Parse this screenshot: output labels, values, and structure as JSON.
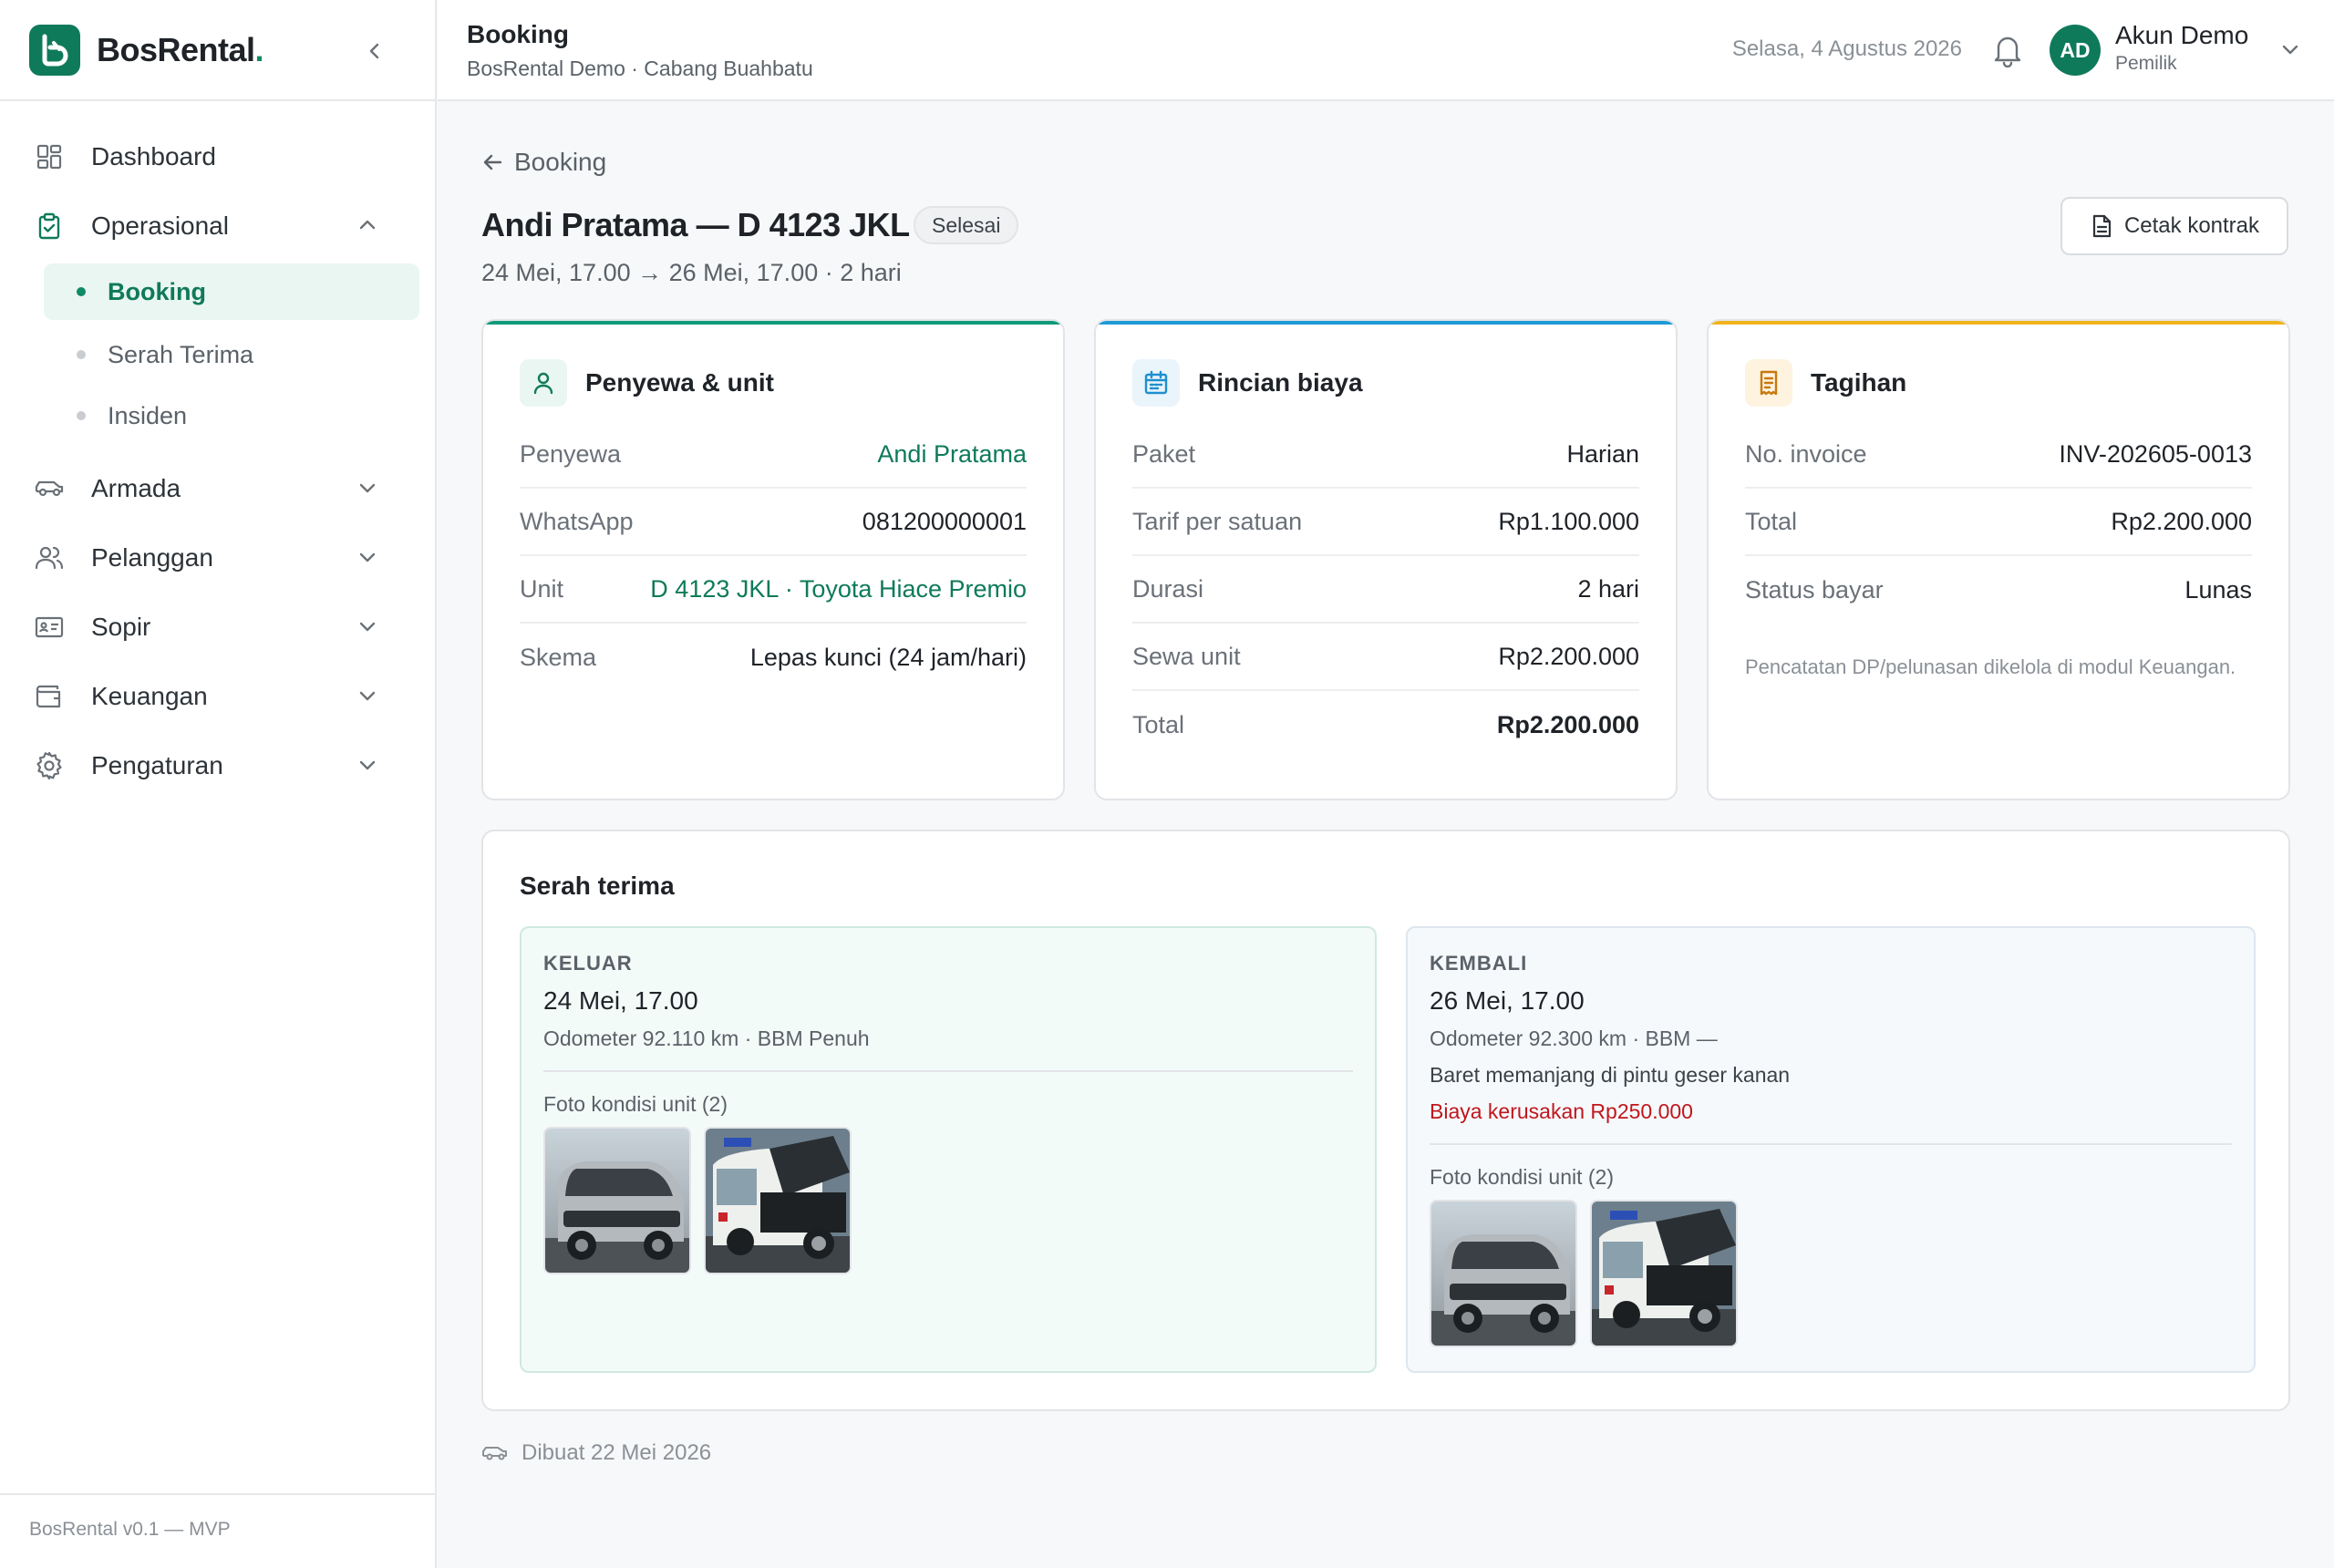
{
  "app": {
    "brand": "BosRental",
    "brand_dot": ".",
    "version": "BosRental v0.1 — MVP"
  },
  "sidebar": {
    "items": [
      {
        "label": "Dashboard",
        "icon": "grid-icon"
      },
      {
        "label": "Operasional",
        "icon": "clipboard-check-icon",
        "expanded": true
      },
      {
        "label": "Armada",
        "icon": "car-icon"
      },
      {
        "label": "Pelanggan",
        "icon": "users-icon"
      },
      {
        "label": "Sopir",
        "icon": "id-card-icon"
      },
      {
        "label": "Keuangan",
        "icon": "wallet-icon"
      },
      {
        "label": "Pengaturan",
        "icon": "gear-icon"
      }
    ],
    "sub_items": [
      {
        "label": "Booking",
        "active": true
      },
      {
        "label": "Serah Terima",
        "active": false
      },
      {
        "label": "Insiden",
        "active": false
      }
    ]
  },
  "header": {
    "title": "Booking",
    "subtitle": "BosRental Demo · Cabang Buahbatu",
    "date": "Selasa, 4 Agustus 2026",
    "user": {
      "initials": "AD",
      "name": "Akun Demo",
      "role": "Pemilik"
    }
  },
  "page": {
    "back_label": "Booking",
    "title": "Andi Pratama — D 4123 JKL",
    "status": "Selesai",
    "period": "24 Mei, 17.00 → 26 Mei, 17.00 · 2 hari",
    "print_label": "Cetak kontrak",
    "created": "Dibuat 22 Mei 2026"
  },
  "renter_card": {
    "title": "Penyewa & unit",
    "rows": [
      {
        "k": "Penyewa",
        "v": "Andi Pratama"
      },
      {
        "k": "WhatsApp",
        "v": "081200000001"
      },
      {
        "k": "Unit",
        "v": "D 4123 JKL · Toyota Hiace Premio"
      },
      {
        "k": "Skema",
        "v": "Lepas kunci (24 jam/hari)"
      }
    ]
  },
  "cost_card": {
    "title": "Rincian biaya",
    "rows": [
      {
        "k": "Paket",
        "v": "Harian"
      },
      {
        "k": "Tarif per satuan",
        "v": "Rp1.100.000"
      },
      {
        "k": "Durasi",
        "v": "2 hari"
      },
      {
        "k": "Sewa unit",
        "v": "Rp2.200.000"
      },
      {
        "k": "Total",
        "v": "Rp2.200.000"
      }
    ]
  },
  "bill_card": {
    "title": "Tagihan",
    "rows": [
      {
        "k": "No. invoice",
        "v": "INV-202605-0013"
      },
      {
        "k": "Total",
        "v": "Rp2.200.000"
      },
      {
        "k": "Status bayar",
        "v": "Lunas"
      }
    ],
    "note": "Pencatatan DP/pelunasan dikelola di modul Keuangan."
  },
  "handover": {
    "title": "Serah terima",
    "out": {
      "label": "KELUAR",
      "date": "24 Mei, 17.00",
      "meta": "Odometer 92.110 km · BBM Penuh",
      "photos_label": "Foto kondisi unit (2)"
    },
    "return": {
      "label": "KEMBALI",
      "date": "26 Mei, 17.00",
      "meta": "Odometer 92.300 km · BBM —",
      "damage_note": "Baret memanjang di pintu geser kanan",
      "damage_cost": "Biaya kerusakan Rp250.000",
      "photos_label": "Foto kondisi unit (2)"
    }
  },
  "colors": {
    "brand": "#0f7a5a",
    "accent_teal": "#0f9a7a",
    "accent_blue": "#1e9bd7",
    "accent_amber": "#f0b41c",
    "danger": "#c0161c"
  }
}
